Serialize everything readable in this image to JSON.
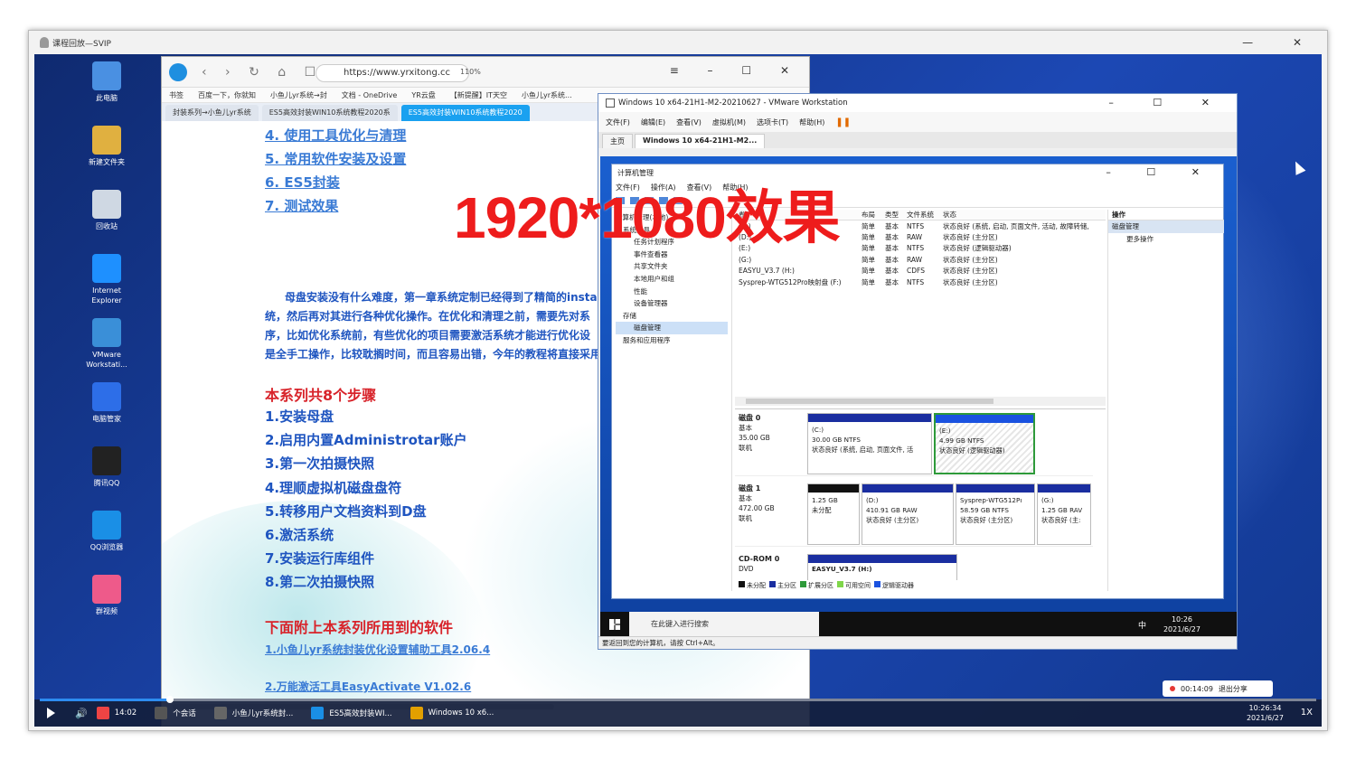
{
  "player": {
    "title": "课程回放—SVIP"
  },
  "desktop_icons": [
    {
      "label": "此电脑",
      "color": "#4a90e2"
    },
    {
      "label": "新建文件夹",
      "color": "#e0b040"
    },
    {
      "label": "回收站",
      "color": "#cfd8e3"
    },
    {
      "label": "Internet Explorer",
      "color": "#1e90ff"
    },
    {
      "label": "VMware Workstati...",
      "color": "#3a8fd8"
    },
    {
      "label": "电脑管家",
      "color": "#2d6ee8"
    },
    {
      "label": "腾讯QQ",
      "color": "#222222"
    },
    {
      "label": "QQ浏览器",
      "color": "#1a8fe6"
    },
    {
      "label": "群视频",
      "color": "#ee5a8a"
    }
  ],
  "browser": {
    "url": "https://www.yrxitong.cc",
    "zoom": "110%",
    "bookmarks": [
      "书签",
      "百度一下，你就知",
      "小鱼儿yr系统→封",
      "文档 - OneDrive",
      "YR云盘",
      "【新提醒】IT天空",
      "小鱼儿yr系统..."
    ],
    "tabs": [
      "封装系列→小鱼儿yr系统",
      "ES5高效封装WIN10系统教程2020系",
      "ES5高效封装WIN10系统教程2020"
    ],
    "toc": [
      "4. 使用工具优化与清理",
      "5. 常用软件安装及设置",
      "6. ES5封装",
      "7. 测试效果"
    ],
    "paragraph": [
      "母盘安装没有什么难度，第一章系统定制已经得到了精简的instal",
      "统，然后再对其进行各种优化操作。在优化和清理之前，需要先对系",
      "序，比如优化系统前，有些优化的项目需要激活系统才能进行优化设",
      "是全手工操作，比较耽搁时间，而且容易出错，今年的教程将直接采用"
    ],
    "steps_title": "本系列共8个步骤",
    "steps": [
      "1.安装母盘",
      "2.启用内置Administrotar账户",
      "3.第一次拍摄快照",
      "4.理顺虚拟机磁盘盘符",
      "5.转移用户文档资料到D盘",
      "6.激活系统",
      "7.安装运行库组件",
      "8.第二次拍摄快照"
    ],
    "soft_title": "下面附上本系列所用到的软件",
    "soft": [
      "1.小鱼儿yr系统封装优化设置辅助工具2.06.4",
      "2.万能激活工具EasyActivate V1.02.6"
    ]
  },
  "vmware": {
    "title": "Windows 10 x64-21H1-M2-20210627 - VMware Workstation",
    "menu": [
      "文件(F)",
      "编辑(E)",
      "查看(V)",
      "虚拟机(M)",
      "选项卡(T)",
      "帮助(H)"
    ],
    "tabs": [
      "主页",
      "Windows 10 x64-21H1-M2..."
    ],
    "status": "要返回到您的计算机，请按 Ctrl+Alt。"
  },
  "compmgmt": {
    "title": "计算机管理",
    "menu": [
      "文件(F)",
      "操作(A)",
      "查看(V)",
      "帮助(H)"
    ],
    "tree": [
      "计算机管理(本地)",
      "系统工具",
      "任务计划程序",
      "事件查看器",
      "共享文件夹",
      "本地用户和组",
      "性能",
      "设备管理器",
      "存储",
      "磁盘管理",
      "服务和应用程序"
    ],
    "vol_headers": [
      "卷",
      "布局",
      "类型",
      "文件系统",
      "状态"
    ],
    "volumes": [
      {
        "name": "(C:)",
        "layout": "简单",
        "type": "基本",
        "fs": "NTFS",
        "status": "状态良好 (系统, 启动, 页面文件, 活动, 故障转储,"
      },
      {
        "name": "(D:)",
        "layout": "简单",
        "type": "基本",
        "fs": "RAW",
        "status": "状态良好 (主分区)"
      },
      {
        "name": "(E:)",
        "layout": "简单",
        "type": "基本",
        "fs": "NTFS",
        "status": "状态良好 (逻辑驱动器)"
      },
      {
        "name": "(G:)",
        "layout": "简单",
        "type": "基本",
        "fs": "RAW",
        "status": "状态良好 (主分区)"
      },
      {
        "name": "EASYU_V3.7 (H:)",
        "layout": "简单",
        "type": "基本",
        "fs": "CDFS",
        "status": "状态良好 (主分区)"
      },
      {
        "name": "Sysprep-WTG512Pro映射盘 (F:)",
        "layout": "简单",
        "type": "基本",
        "fs": "NTFS",
        "status": "状态良好 (主分区)"
      }
    ],
    "actions_header": "操作",
    "actions_section": "磁盘管理",
    "actions_more": "更多操作",
    "disk0": {
      "name": "磁盘 0",
      "type": "基本",
      "size": "35.00 GB",
      "state": "联机",
      "parts": [
        {
          "l1": "(C:)",
          "l2": "30.00 GB NTFS",
          "l3": "状态良好 (系统, 启动, 页面文件, 活"
        },
        {
          "l1": "(E:)",
          "l2": "4.99 GB NTFS",
          "l3": "状态良好 (逻辑驱动器)"
        }
      ]
    },
    "disk1": {
      "name": "磁盘 1",
      "type": "基本",
      "size": "472.00 GB",
      "state": "联机",
      "parts": [
        {
          "l1": "",
          "l2": "1.25 GB",
          "l3": "未分配"
        },
        {
          "l1": "(D:)",
          "l2": "410.91 GB RAW",
          "l3": "状态良好 (主分区)"
        },
        {
          "l1": "Sysprep-WTG512Pı",
          "l2": "58.59 GB NTFS",
          "l3": "状态良好 (主分区)"
        },
        {
          "l1": "(G:)",
          "l2": "1.25 GB RAV",
          "l3": "状态良好 (主:"
        }
      ]
    },
    "cdrom": {
      "name": "CD-ROM 0",
      "type": "DVD",
      "part": "EASYU_V3.7  (H:)"
    },
    "legend": [
      "未分配",
      "主分区",
      "扩展分区",
      "可用空间",
      "逻辑驱动器"
    ]
  },
  "guest_taskbar": {
    "search": "在此键入进行搜索",
    "time": "10:26",
    "date": "2021/6/27",
    "ime": "中"
  },
  "overlay_title": "1920*1080效果",
  "share": {
    "timer": "00:14:09",
    "exit": "退出分享"
  },
  "host_taskbar": {
    "items": [
      "14:02",
      "个会话",
      "小鱼儿yr系统封...",
      "ES5高效封装WI...",
      "Windows 10 x6..."
    ],
    "time": "10:26:34",
    "date": "2021/6/27",
    "speed": "1X"
  }
}
